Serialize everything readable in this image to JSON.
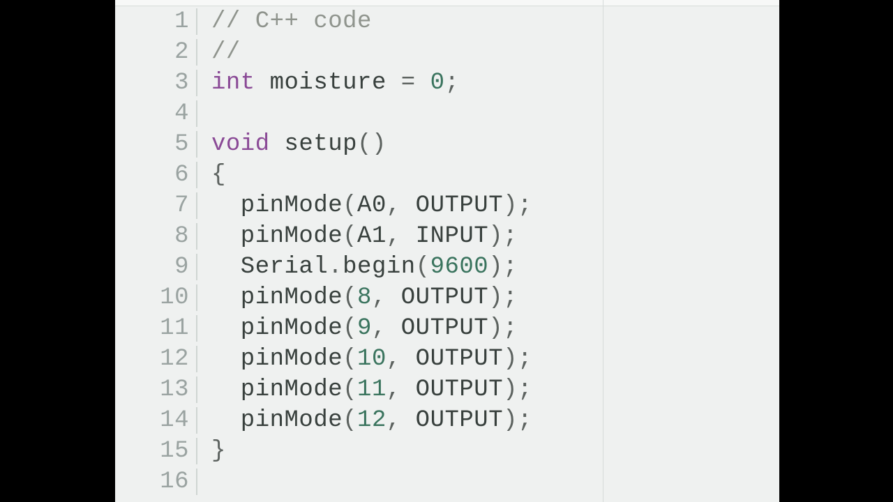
{
  "lines": [
    {
      "num": "1",
      "tokens": [
        {
          "t": "// C++ code",
          "c": "tok-comment"
        }
      ]
    },
    {
      "num": "2",
      "tokens": [
        {
          "t": "//",
          "c": "tok-comment"
        }
      ]
    },
    {
      "num": "3",
      "tokens": [
        {
          "t": "int",
          "c": "tok-keyword"
        },
        {
          "t": " moisture ",
          "c": "tok-ident"
        },
        {
          "t": "=",
          "c": "tok-punct"
        },
        {
          "t": " ",
          "c": "tok-ident"
        },
        {
          "t": "0",
          "c": "tok-number"
        },
        {
          "t": ";",
          "c": "tok-punct"
        }
      ]
    },
    {
      "num": "4",
      "tokens": []
    },
    {
      "num": "5",
      "tokens": [
        {
          "t": "void",
          "c": "tok-keyword"
        },
        {
          "t": " setup",
          "c": "tok-ident"
        },
        {
          "t": "()",
          "c": "tok-punct"
        }
      ]
    },
    {
      "num": "6",
      "tokens": [
        {
          "t": "{",
          "c": "tok-punct"
        }
      ]
    },
    {
      "num": "7",
      "tokens": [
        {
          "t": "  pinMode",
          "c": "tok-ident"
        },
        {
          "t": "(",
          "c": "tok-punct"
        },
        {
          "t": "A0",
          "c": "tok-ident"
        },
        {
          "t": ", ",
          "c": "tok-punct"
        },
        {
          "t": "OUTPUT",
          "c": "tok-ident"
        },
        {
          "t": ");",
          "c": "tok-punct"
        }
      ]
    },
    {
      "num": "8",
      "tokens": [
        {
          "t": "  pinMode",
          "c": "tok-ident"
        },
        {
          "t": "(",
          "c": "tok-punct"
        },
        {
          "t": "A1",
          "c": "tok-ident"
        },
        {
          "t": ", ",
          "c": "tok-punct"
        },
        {
          "t": "INPUT",
          "c": "tok-ident"
        },
        {
          "t": ");",
          "c": "tok-punct"
        }
      ]
    },
    {
      "num": "9",
      "tokens": [
        {
          "t": "  Serial",
          "c": "tok-ident"
        },
        {
          "t": ".",
          "c": "tok-punct"
        },
        {
          "t": "begin",
          "c": "tok-ident"
        },
        {
          "t": "(",
          "c": "tok-punct"
        },
        {
          "t": "9600",
          "c": "tok-number"
        },
        {
          "t": ");",
          "c": "tok-punct"
        }
      ]
    },
    {
      "num": "10",
      "tokens": [
        {
          "t": "  pinMode",
          "c": "tok-ident"
        },
        {
          "t": "(",
          "c": "tok-punct"
        },
        {
          "t": "8",
          "c": "tok-number"
        },
        {
          "t": ", ",
          "c": "tok-punct"
        },
        {
          "t": "OUTPUT",
          "c": "tok-ident"
        },
        {
          "t": ");",
          "c": "tok-punct"
        }
      ]
    },
    {
      "num": "11",
      "tokens": [
        {
          "t": "  pinMode",
          "c": "tok-ident"
        },
        {
          "t": "(",
          "c": "tok-punct"
        },
        {
          "t": "9",
          "c": "tok-number"
        },
        {
          "t": ", ",
          "c": "tok-punct"
        },
        {
          "t": "OUTPUT",
          "c": "tok-ident"
        },
        {
          "t": ");",
          "c": "tok-punct"
        }
      ]
    },
    {
      "num": "12",
      "tokens": [
        {
          "t": "  pinMode",
          "c": "tok-ident"
        },
        {
          "t": "(",
          "c": "tok-punct"
        },
        {
          "t": "10",
          "c": "tok-number"
        },
        {
          "t": ", ",
          "c": "tok-punct"
        },
        {
          "t": "OUTPUT",
          "c": "tok-ident"
        },
        {
          "t": ");",
          "c": "tok-punct"
        }
      ]
    },
    {
      "num": "13",
      "tokens": [
        {
          "t": "  pinMode",
          "c": "tok-ident"
        },
        {
          "t": "(",
          "c": "tok-punct"
        },
        {
          "t": "11",
          "c": "tok-number"
        },
        {
          "t": ", ",
          "c": "tok-punct"
        },
        {
          "t": "OUTPUT",
          "c": "tok-ident"
        },
        {
          "t": ");",
          "c": "tok-punct"
        }
      ]
    },
    {
      "num": "14",
      "tokens": [
        {
          "t": "  pinMode",
          "c": "tok-ident"
        },
        {
          "t": "(",
          "c": "tok-punct"
        },
        {
          "t": "12",
          "c": "tok-number"
        },
        {
          "t": ", ",
          "c": "tok-punct"
        },
        {
          "t": "OUTPUT",
          "c": "tok-ident"
        },
        {
          "t": ");",
          "c": "tok-punct"
        }
      ]
    },
    {
      "num": "15",
      "tokens": [
        {
          "t": "}",
          "c": "tok-punct"
        }
      ]
    },
    {
      "num": "16",
      "tokens": []
    }
  ]
}
